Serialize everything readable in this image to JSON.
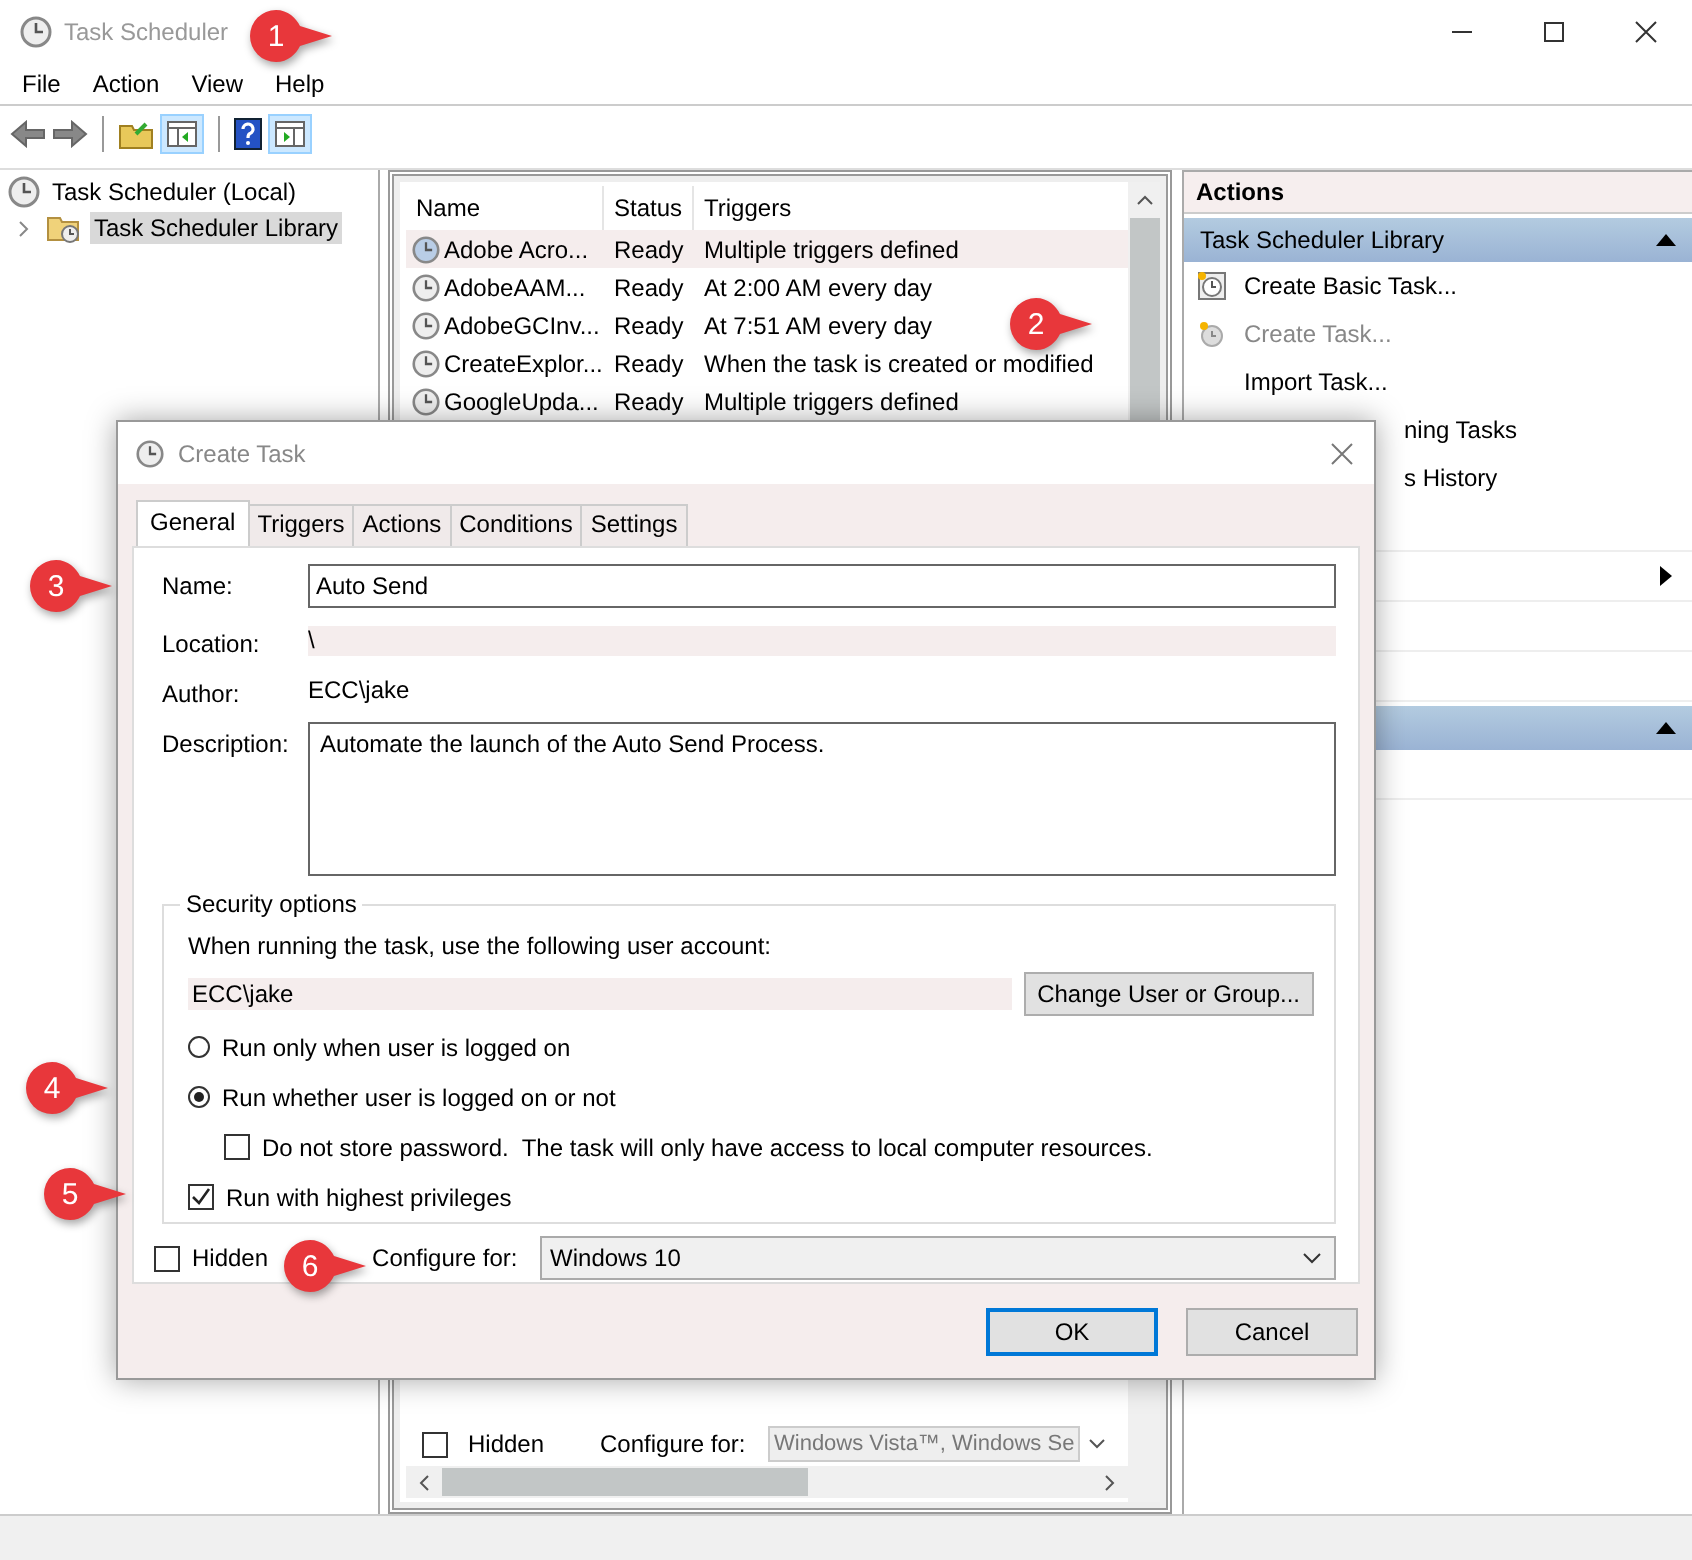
{
  "window": {
    "title": "Task Scheduler"
  },
  "menu": [
    "File",
    "Action",
    "View",
    "Help"
  ],
  "tree": [
    {
      "label": "Task Scheduler (Local)",
      "selected": false,
      "children": [
        {
          "label": "Task Scheduler Library",
          "selected": true,
          "expanded": false
        }
      ]
    }
  ],
  "tasks": {
    "columns": [
      "Name",
      "Status",
      "Triggers"
    ],
    "rows": [
      {
        "name": "Adobe Acro...",
        "status": "Ready",
        "triggers": "Multiple triggers defined",
        "selected": true
      },
      {
        "name": "AdobeAAM...",
        "status": "Ready",
        "triggers": "At 2:00 AM every day",
        "selected": false
      },
      {
        "name": "AdobeGCInv...",
        "status": "Ready",
        "triggers": "At 7:51 AM every day",
        "selected": false
      },
      {
        "name": "CreateExplor...",
        "status": "Ready",
        "triggers": "When the task is created or modified",
        "selected": false
      },
      {
        "name": "GoogleUpda...",
        "status": "Ready",
        "triggers": "Multiple triggers defined",
        "selected": false
      }
    ],
    "hidden": {
      "label": "Hidden",
      "checked": false
    },
    "configure_label": "Configure for:",
    "configure_value": "Windows Vista™, Windows Se"
  },
  "actions": {
    "title": "Actions",
    "sections": [
      {
        "title": "Task Scheduler Library",
        "items": [
          {
            "kind": "item",
            "label": "Create Basic Task...",
            "disabled": false
          },
          {
            "kind": "item",
            "label": "Create Task...",
            "disabled": true
          },
          {
            "kind": "item",
            "label": "Import Task...",
            "disabled": false
          },
          {
            "kind": "partial",
            "label": "ning Tasks"
          },
          {
            "kind": "partial",
            "label": "s History"
          },
          {
            "kind": "blank"
          },
          {
            "kind": "submenu"
          },
          {
            "kind": "blank"
          },
          {
            "kind": "blank"
          }
        ]
      },
      {
        "items": [
          {
            "kind": "blank"
          }
        ]
      }
    ]
  },
  "dialog": {
    "title": "Create Task",
    "tabs": [
      {
        "label": "General",
        "selected": true
      },
      {
        "label": "Triggers",
        "selected": false
      },
      {
        "label": "Actions",
        "selected": false
      },
      {
        "label": "Conditions",
        "selected": false
      },
      {
        "label": "Settings",
        "selected": false
      }
    ],
    "name_label": "Name:",
    "name_value": "Auto Send",
    "location_label": "Location:",
    "location_value": "\\",
    "author_label": "Author:",
    "author_value": "ECC\\jake",
    "description_label": "Description:",
    "description_value": "Automate the launch of the Auto Send Process.",
    "security": {
      "title": "Security options",
      "prompt": "When running the task, use the following user account:",
      "account": "ECC\\jake",
      "change_button": "Change User or Group...",
      "options": [
        {
          "kind": "radio",
          "label": "Run only when user is logged on",
          "checked": false
        },
        {
          "kind": "radio",
          "label": "Run whether user is logged on or not",
          "checked": true,
          "children": [
            {
              "kind": "checkbox",
              "label": "Do not store password.  The task will only have access to local computer resources.",
              "checked": false
            }
          ]
        },
        {
          "kind": "checkbox",
          "label": "Run with highest privileges",
          "checked": true
        }
      ]
    },
    "hidden": {
      "label": "Hidden",
      "checked": false
    },
    "configure_label": "Configure for:",
    "configure_value": "Windows 10",
    "buttons": [
      {
        "label": "OK",
        "default": true
      },
      {
        "label": "Cancel",
        "default": false
      }
    ]
  },
  "callouts": [
    "1",
    "2",
    "3",
    "4",
    "5",
    "6"
  ]
}
